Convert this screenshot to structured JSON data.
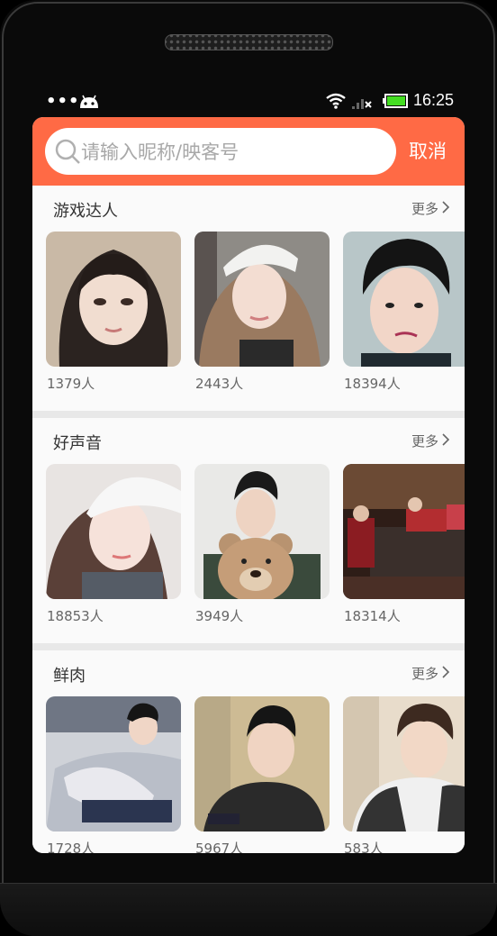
{
  "status_bar": {
    "time": "16:25",
    "overflow": "•••"
  },
  "search": {
    "placeholder": "请输入昵称/映客号",
    "cancel_label": "取消",
    "accent": "#ff6a45"
  },
  "sections": [
    {
      "title": "游戏达人",
      "more_label": "更多",
      "items": [
        {
          "count": "1379人"
        },
        {
          "count": "2443人"
        },
        {
          "count": "18394人"
        }
      ]
    },
    {
      "title": "好声音",
      "more_label": "更多",
      "items": [
        {
          "count": "18853人"
        },
        {
          "count": "3949人"
        },
        {
          "count": "18314人"
        }
      ]
    },
    {
      "title": "鲜肉",
      "more_label": "更多",
      "items": [
        {
          "count": "1728人"
        },
        {
          "count": "5967人"
        },
        {
          "count": "583人"
        }
      ]
    }
  ]
}
